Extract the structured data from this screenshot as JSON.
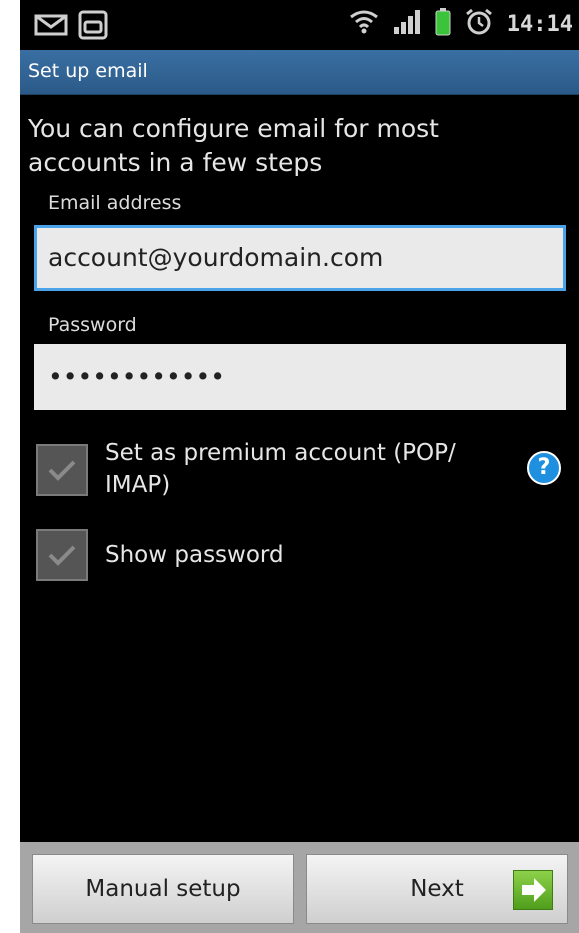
{
  "status_bar": {
    "icons": [
      "mail-icon",
      "app-icon",
      "wifi-icon",
      "signal-icon",
      "battery-icon",
      "alarm-icon"
    ],
    "time": "14:14"
  },
  "header": {
    "title": "Set up email"
  },
  "intro_text": "You can configure email for most accounts in a few steps",
  "form": {
    "email_label": "Email address",
    "email_value": "account@yourdomain.com",
    "password_label": "Password",
    "password_value": "••••••••••••",
    "premium_checkbox_label": "Set as premium account (POP/ IMAP)",
    "show_password_label": "Show password",
    "help_icon_glyph": "?"
  },
  "buttons": {
    "manual_setup": "Manual setup",
    "next": "Next"
  },
  "colors": {
    "title_bar": "#2b5a88",
    "focus_border": "#4aa3e8",
    "help_icon": "#1f8fe0",
    "next_icon": "#5fb226"
  }
}
